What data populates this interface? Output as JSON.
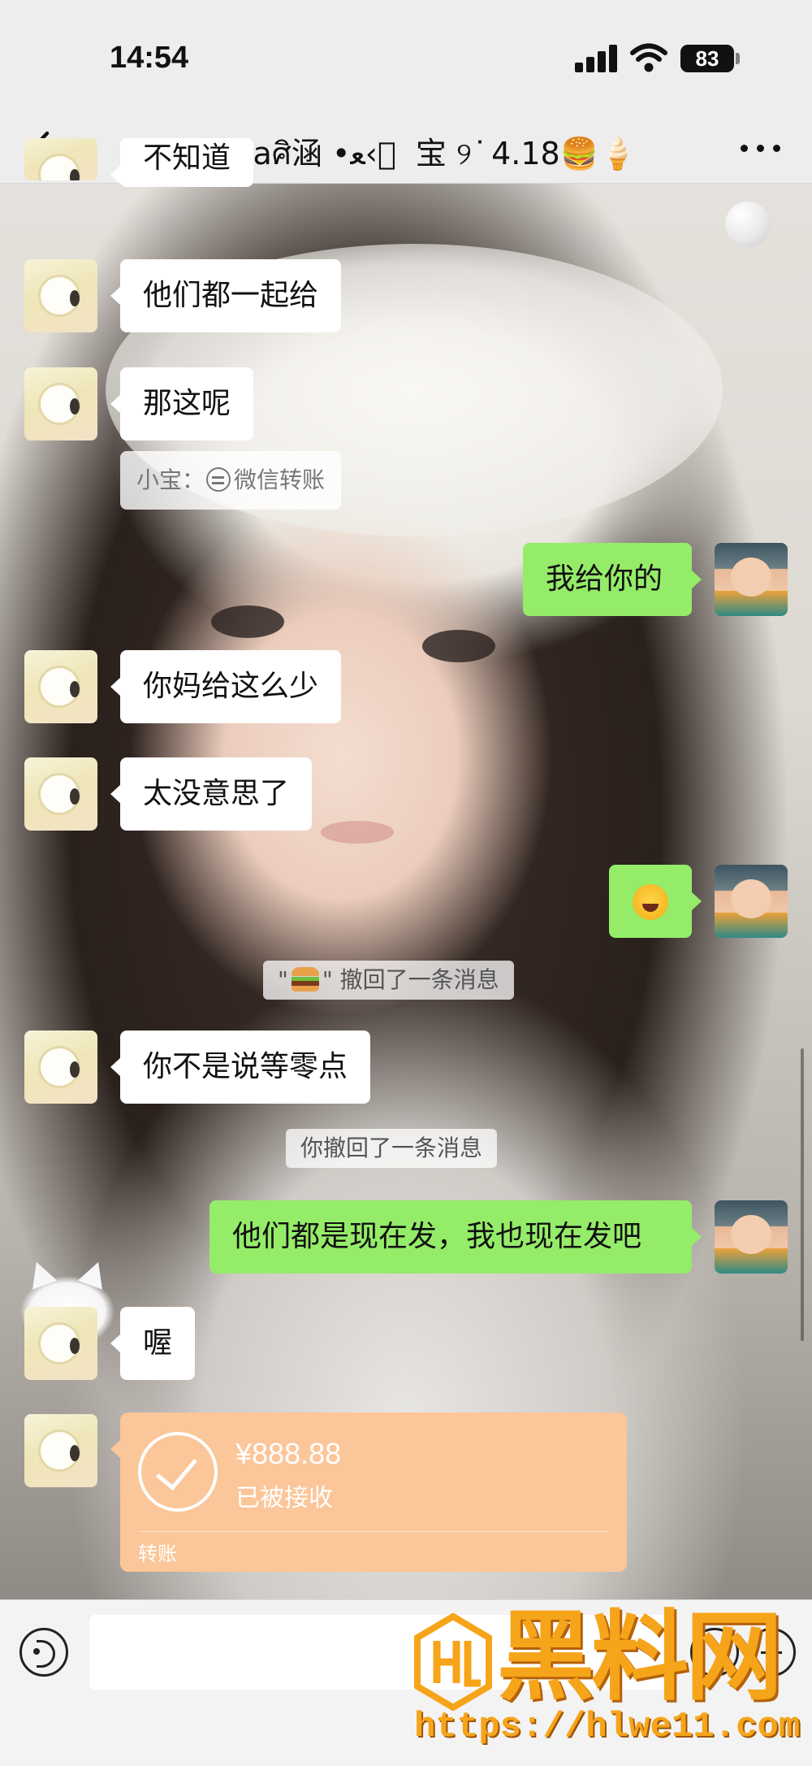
{
  "status_bar": {
    "time": "14:54",
    "battery": "83",
    "icons": [
      "signal-icon",
      "wifi-icon",
      "battery-icon"
    ]
  },
  "nav": {
    "back_icon": "chevron-left-icon",
    "title": "Aaaaaศิ涵 •ﻌ‹ ⃝ 宝 ୨ ͘ 4.18🍔🍦",
    "more_icon": "more-dots-icon"
  },
  "messages": [
    {
      "side": "in",
      "text": "不知道"
    },
    {
      "side": "in",
      "text": "他们都一起给"
    },
    {
      "side": "in",
      "text": "那这呢",
      "quote": {
        "sender": "小宝：",
        "text": "微信转账"
      }
    },
    {
      "side": "out",
      "text": "我给你的"
    },
    {
      "side": "in",
      "text": "你妈给这么少"
    },
    {
      "side": "in",
      "text": "太没意思了"
    },
    {
      "side": "out",
      "emoji": "laughing-tears-emoji"
    },
    {
      "type": "system",
      "text_prefix": "\"",
      "text_suffix": "\" 撤回了一条消息"
    },
    {
      "side": "in",
      "text": "你不是说等零点"
    },
    {
      "type": "system",
      "text": "你撤回了一条消息"
    },
    {
      "side": "out",
      "text": "他们都是现在发，我也现在发吧"
    },
    {
      "side": "in",
      "text": "喔"
    },
    {
      "side": "in",
      "type": "transfer",
      "amount": "¥888.88",
      "status": "已被接收",
      "label": "转账"
    }
  ],
  "input_bar": {
    "icons": [
      "voice-icon",
      "emoji-icon",
      "plus-icon"
    ]
  },
  "watermark": {
    "title": "黑料网",
    "url": "https://hlwe11.com"
  },
  "colors": {
    "outgoing_bubble": "#95ec69",
    "incoming_bubble": "#ffffff",
    "transfer_card": "#fbc699",
    "watermark": "#f6a41a"
  }
}
